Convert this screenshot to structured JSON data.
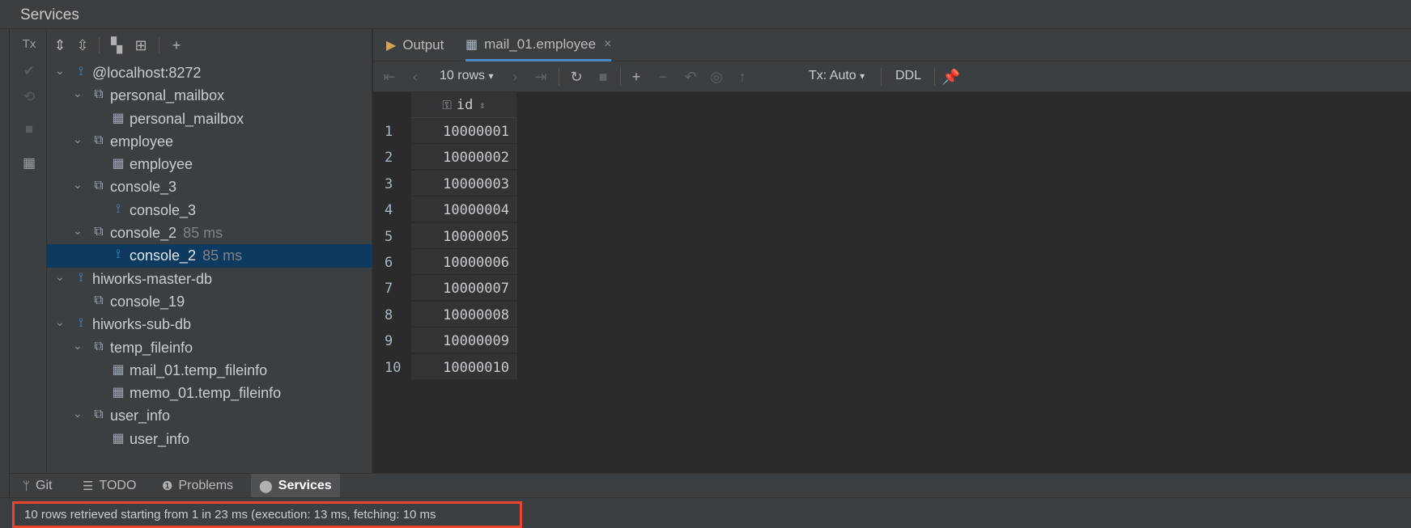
{
  "window": {
    "title": "Services"
  },
  "left_toolbar": {
    "tx_label": "Tx",
    "icons": [
      "commit-check-icon",
      "rollback-icon",
      "stop-icon",
      "layout-icon"
    ]
  },
  "tree_toolbar": {
    "icons": [
      "expand-all-icon",
      "collapse-all-icon",
      "group-by-icon",
      "new-layout-icon",
      "add-icon"
    ]
  },
  "tree": {
    "items": [
      {
        "label": "@localhost:8272",
        "ms": "",
        "icon": "datasource-icon",
        "expanded": true,
        "depth": 0,
        "selected": false
      },
      {
        "label": "personal_mailbox",
        "ms": "",
        "icon": "session-icon",
        "expanded": true,
        "depth": 1,
        "selected": false
      },
      {
        "label": "personal_mailbox",
        "ms": "",
        "icon": "table-icon",
        "expanded": null,
        "depth": 2,
        "selected": false
      },
      {
        "label": "employee",
        "ms": "",
        "icon": "session-icon",
        "expanded": true,
        "depth": 1,
        "selected": false
      },
      {
        "label": "employee",
        "ms": "",
        "icon": "table-icon",
        "expanded": null,
        "depth": 2,
        "selected": false
      },
      {
        "label": "console_3",
        "ms": "",
        "icon": "session-icon",
        "expanded": true,
        "depth": 1,
        "selected": false
      },
      {
        "label": "console_3",
        "ms": "",
        "icon": "console-icon",
        "expanded": null,
        "depth": 2,
        "selected": false
      },
      {
        "label": "console_2",
        "ms": "85 ms",
        "icon": "session-active-icon",
        "expanded": true,
        "depth": 1,
        "selected": false
      },
      {
        "label": "console_2",
        "ms": "85 ms",
        "icon": "console-icon",
        "expanded": null,
        "depth": 2,
        "selected": true
      },
      {
        "label": "hiworks-master-db",
        "ms": "",
        "icon": "datasource-icon",
        "expanded": true,
        "depth": 0,
        "selected": false
      },
      {
        "label": "console_19",
        "ms": "",
        "icon": "session-icon",
        "expanded": null,
        "depth": 1,
        "selected": false
      },
      {
        "label": "hiworks-sub-db",
        "ms": "",
        "icon": "datasource-icon",
        "expanded": true,
        "depth": 0,
        "selected": false
      },
      {
        "label": "temp_fileinfo",
        "ms": "",
        "icon": "session-icon",
        "expanded": true,
        "depth": 1,
        "selected": false
      },
      {
        "label": "mail_01.temp_fileinfo",
        "ms": "",
        "icon": "table-icon",
        "expanded": null,
        "depth": 2,
        "selected": false
      },
      {
        "label": "memo_01.temp_fileinfo",
        "ms": "",
        "icon": "table-icon",
        "expanded": null,
        "depth": 2,
        "selected": false
      },
      {
        "label": "user_info",
        "ms": "",
        "icon": "session-icon",
        "expanded": true,
        "depth": 1,
        "selected": false
      },
      {
        "label": "user_info",
        "ms": "",
        "icon": "table-icon",
        "expanded": null,
        "depth": 2,
        "selected": false
      }
    ]
  },
  "tabs": [
    {
      "label": "Output",
      "icon": "output-icon",
      "active": false
    },
    {
      "label": "mail_01.employee",
      "icon": "table-icon",
      "active": true
    }
  ],
  "grid_toolbar": {
    "rows_label": "10 rows",
    "tx_label": "Tx: Auto",
    "ddl_label": "DDL"
  },
  "table": {
    "column": "id",
    "rows": [
      {
        "n": "1",
        "id": "10000001"
      },
      {
        "n": "2",
        "id": "10000002"
      },
      {
        "n": "3",
        "id": "10000003"
      },
      {
        "n": "4",
        "id": "10000004"
      },
      {
        "n": "5",
        "id": "10000005"
      },
      {
        "n": "6",
        "id": "10000006"
      },
      {
        "n": "7",
        "id": "10000007"
      },
      {
        "n": "8",
        "id": "10000008"
      },
      {
        "n": "9",
        "id": "10000009"
      },
      {
        "n": "10",
        "id": "10000010"
      }
    ]
  },
  "bottom_tabs": [
    {
      "label": "Git",
      "icon": "git-branch-icon",
      "active": false
    },
    {
      "label": "TODO",
      "icon": "todo-list-icon",
      "active": false
    },
    {
      "label": "Problems",
      "icon": "problems-icon",
      "active": false
    },
    {
      "label": "Services",
      "icon": "services-icon",
      "active": true
    }
  ],
  "status": {
    "text": "10 rows retrieved starting from 1 in 23 ms (execution: 13 ms, fetching: 10 ms",
    "highlight_color": "#e8452c"
  },
  "colors": {
    "selection": "#0d3a5e",
    "datasource": "#3c8fd6",
    "active_tab_underline": "#4a88c7"
  }
}
